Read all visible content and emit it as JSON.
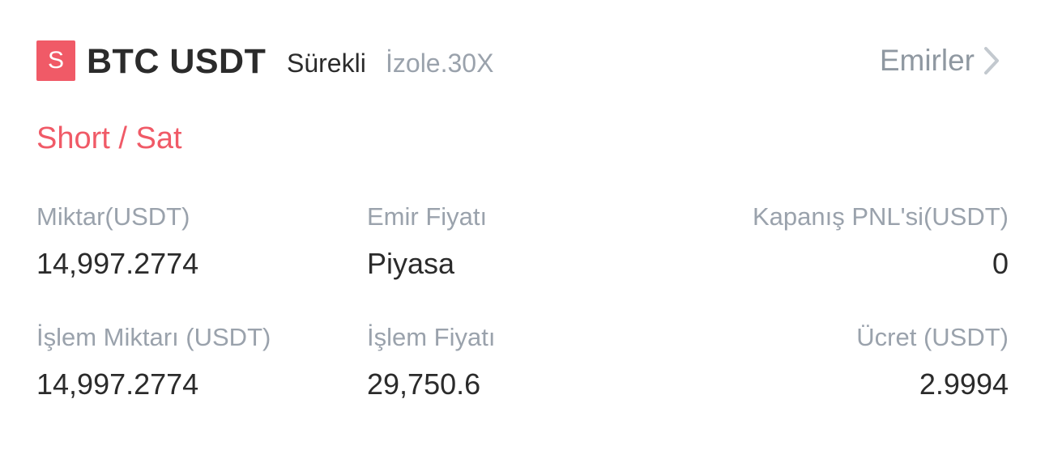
{
  "header": {
    "badge_letter": "S",
    "pair": "BTC USDT",
    "contract_type": "Sürekli",
    "margin_mode": "İzole.30X",
    "orders_link": "Emirler",
    "chevron_icon": "chevron-right-icon"
  },
  "order": {
    "side_label": "Short / Sat",
    "fields": {
      "quantity_label": "Miktar(USDT)",
      "quantity_value": "14,997.2774",
      "order_price_label": "Emir Fiyatı",
      "order_price_value": "Piyasa",
      "close_pnl_label": "Kapanış PNL'si(USDT)",
      "close_pnl_value": "0",
      "trade_amount_label": "İşlem Miktarı (USDT)",
      "trade_amount_value": "14,997.2774",
      "trade_price_label": "İşlem Fiyatı",
      "trade_price_value": "29,750.6",
      "fee_label": "Ücret (USDT)",
      "fee_value": "2.9994"
    }
  },
  "colors": {
    "short_red": "#f05a67",
    "label_gray": "#9aa2ac",
    "value_dark": "#2b2b2b",
    "link_gray": "#8f98a1"
  }
}
